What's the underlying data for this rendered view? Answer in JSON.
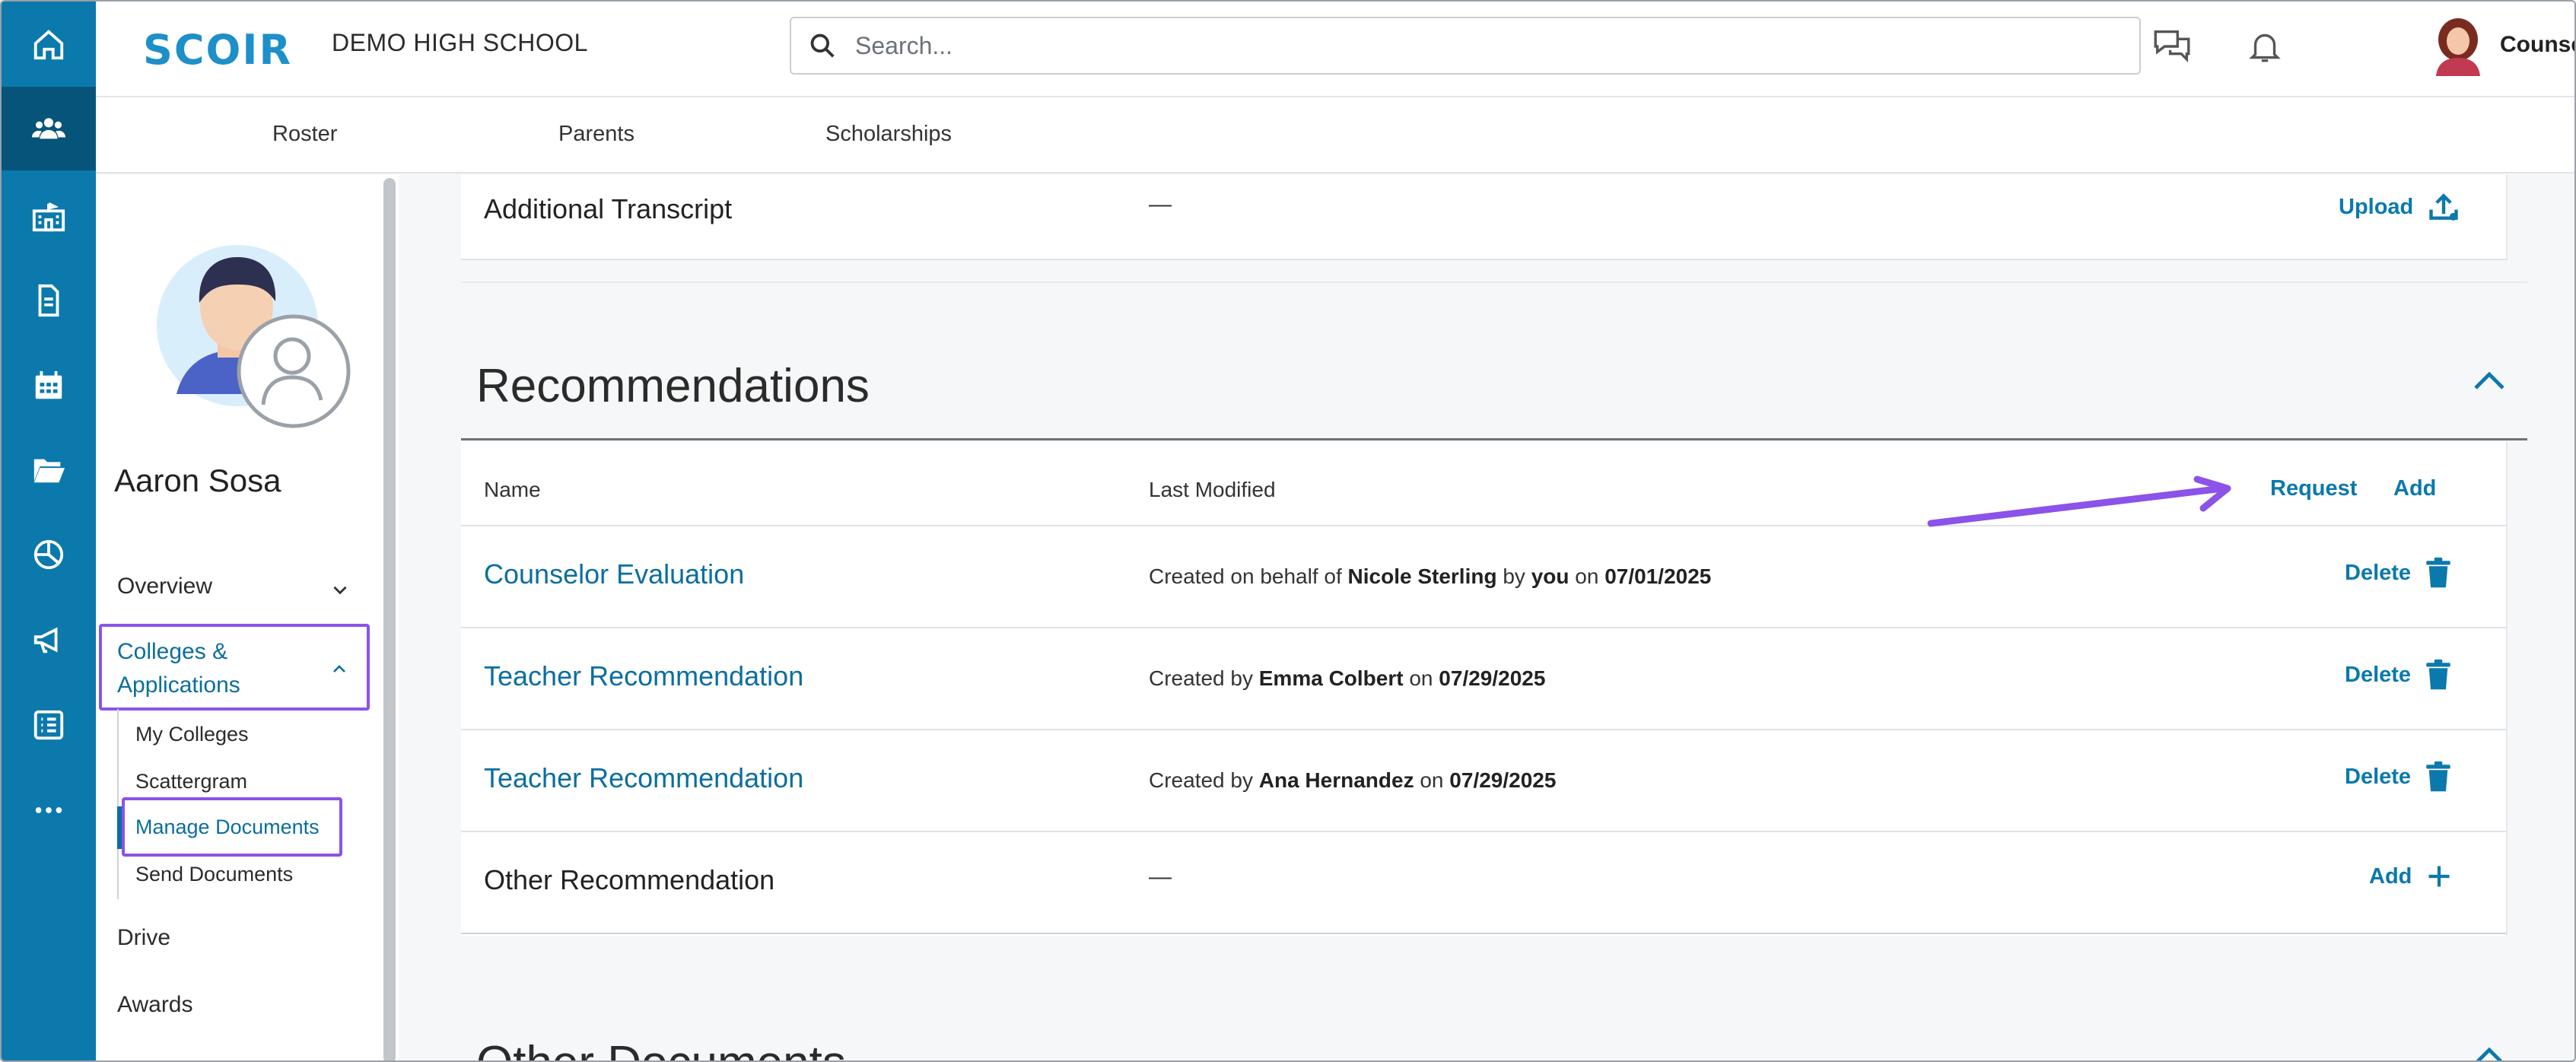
{
  "brand": {
    "logo": "SCOIR",
    "school": "DEMO HIGH SCHOOL"
  },
  "colors": {
    "rail": "#0b79ac",
    "rail_active": "#07547a",
    "accent": "#0b79ac",
    "highlight": "#8b53e8"
  },
  "rail": {
    "icons": [
      "home-icon",
      "people-icon",
      "school-icon",
      "document-icon",
      "calendar-icon",
      "folder-icon",
      "chart-icon",
      "megaphone-icon",
      "checklist-icon",
      "more-icon"
    ],
    "active": "people-icon"
  },
  "search": {
    "placeholder": "Search..."
  },
  "header": {
    "user_label": "Counselor"
  },
  "subnav": {
    "items": [
      "Roster",
      "Parents",
      "Scholarships"
    ]
  },
  "profile": {
    "name": "Aaron Sosa",
    "nav": {
      "overview": "Overview",
      "colleges_line1": "Colleges &",
      "colleges_line2": "Applications",
      "sub": [
        "My Colleges",
        "Scattergram",
        "Manage Documents",
        "Send Documents"
      ],
      "drive": "Drive",
      "awards": "Awards"
    }
  },
  "transcript": {
    "label": "Additional Transcript",
    "modified": "—",
    "action": "Upload"
  },
  "recommendations": {
    "title": "Recommendations",
    "columns": {
      "name": "Name",
      "modified": "Last Modified"
    },
    "header_actions": {
      "request": "Request",
      "add": "Add"
    },
    "rows": [
      {
        "name": "Counselor Evaluation",
        "prefix": "Created on behalf of",
        "person": "Nicole Sterling",
        "by": "by",
        "by_who": "you",
        "on": "on",
        "date": "07/01/2025",
        "action": "Delete"
      },
      {
        "name": "Teacher Recommendation",
        "prefix": "Created by",
        "person": "Emma Colbert",
        "on": "on",
        "date": "07/29/2025",
        "action": "Delete"
      },
      {
        "name": "Teacher Recommendation",
        "prefix": "Created by",
        "person": "Ana Hernandez",
        "on": "on",
        "date": "07/29/2025",
        "action": "Delete"
      }
    ],
    "other": {
      "name": "Other Recommendation",
      "modified": "—",
      "action": "Add"
    }
  },
  "other_documents": {
    "title": "Other Documents"
  }
}
